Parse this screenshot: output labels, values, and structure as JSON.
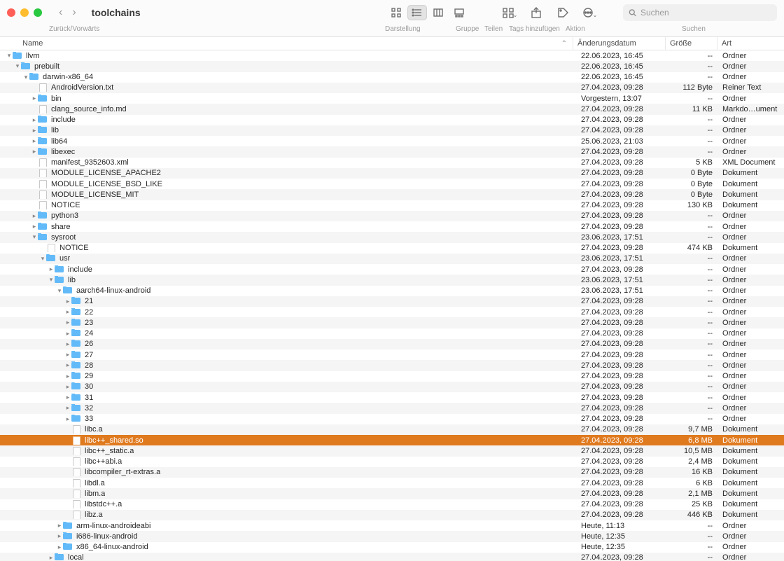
{
  "toolbar": {
    "back_forward_label": "Zurück/Vorwärts",
    "title": "toolchains",
    "view_label": "Darstellung",
    "group_label": "Gruppe",
    "share_label": "Teilen",
    "tags_label": "Tags hinzufügen",
    "action_label": "Aktion",
    "search_label": "Suchen",
    "search_placeholder": "Suchen"
  },
  "columns": {
    "name": "Name",
    "date": "Änderungsdatum",
    "size": "Größe",
    "kind": "Art"
  },
  "rows": [
    {
      "depth": 0,
      "disc": "down",
      "type": "folder",
      "name": "llvm",
      "date": "22.06.2023, 16:45",
      "size": "--",
      "kind": "Ordner",
      "sel": false
    },
    {
      "depth": 1,
      "disc": "down",
      "type": "folder",
      "name": "prebuilt",
      "date": "22.06.2023, 16:45",
      "size": "--",
      "kind": "Ordner",
      "sel": false
    },
    {
      "depth": 2,
      "disc": "down",
      "type": "folder",
      "name": "darwin-x86_64",
      "date": "22.06.2023, 16:45",
      "size": "--",
      "kind": "Ordner",
      "sel": false
    },
    {
      "depth": 3,
      "disc": "none",
      "type": "file",
      "name": "AndroidVersion.txt",
      "date": "27.04.2023, 09:28",
      "size": "112 Byte",
      "kind": "Reiner Text",
      "sel": false
    },
    {
      "depth": 3,
      "disc": "right",
      "type": "folder",
      "name": "bin",
      "date": "Vorgestern, 13:07",
      "size": "--",
      "kind": "Ordner",
      "sel": false
    },
    {
      "depth": 3,
      "disc": "none",
      "type": "file",
      "name": "clang_source_info.md",
      "date": "27.04.2023, 09:28",
      "size": "11 KB",
      "kind": "Markdo…ument",
      "sel": false
    },
    {
      "depth": 3,
      "disc": "right",
      "type": "folder",
      "name": "include",
      "date": "27.04.2023, 09:28",
      "size": "--",
      "kind": "Ordner",
      "sel": false
    },
    {
      "depth": 3,
      "disc": "right",
      "type": "folder",
      "name": "lib",
      "date": "27.04.2023, 09:28",
      "size": "--",
      "kind": "Ordner",
      "sel": false
    },
    {
      "depth": 3,
      "disc": "right",
      "type": "folder",
      "name": "lib64",
      "date": "25.06.2023, 21:03",
      "size": "--",
      "kind": "Ordner",
      "sel": false
    },
    {
      "depth": 3,
      "disc": "right",
      "type": "folder",
      "name": "libexec",
      "date": "27.04.2023, 09:28",
      "size": "--",
      "kind": "Ordner",
      "sel": false
    },
    {
      "depth": 3,
      "disc": "none",
      "type": "file",
      "name": "manifest_9352603.xml",
      "date": "27.04.2023, 09:28",
      "size": "5 KB",
      "kind": "XML Document",
      "sel": false
    },
    {
      "depth": 3,
      "disc": "none",
      "type": "file",
      "name": "MODULE_LICENSE_APACHE2",
      "date": "27.04.2023, 09:28",
      "size": "0 Byte",
      "kind": "Dokument",
      "sel": false
    },
    {
      "depth": 3,
      "disc": "none",
      "type": "file",
      "name": "MODULE_LICENSE_BSD_LIKE",
      "date": "27.04.2023, 09:28",
      "size": "0 Byte",
      "kind": "Dokument",
      "sel": false
    },
    {
      "depth": 3,
      "disc": "none",
      "type": "file",
      "name": "MODULE_LICENSE_MIT",
      "date": "27.04.2023, 09:28",
      "size": "0 Byte",
      "kind": "Dokument",
      "sel": false
    },
    {
      "depth": 3,
      "disc": "none",
      "type": "file",
      "name": "NOTICE",
      "date": "27.04.2023, 09:28",
      "size": "130 KB",
      "kind": "Dokument",
      "sel": false
    },
    {
      "depth": 3,
      "disc": "right",
      "type": "folder",
      "name": "python3",
      "date": "27.04.2023, 09:28",
      "size": "--",
      "kind": "Ordner",
      "sel": false
    },
    {
      "depth": 3,
      "disc": "right",
      "type": "folder",
      "name": "share",
      "date": "27.04.2023, 09:28",
      "size": "--",
      "kind": "Ordner",
      "sel": false
    },
    {
      "depth": 3,
      "disc": "down",
      "type": "folder",
      "name": "sysroot",
      "date": "23.06.2023, 17:51",
      "size": "--",
      "kind": "Ordner",
      "sel": false
    },
    {
      "depth": 4,
      "disc": "none",
      "type": "file",
      "name": "NOTICE",
      "date": "27.04.2023, 09:28",
      "size": "474 KB",
      "kind": "Dokument",
      "sel": false
    },
    {
      "depth": 4,
      "disc": "down",
      "type": "folder",
      "name": "usr",
      "date": "23.06.2023, 17:51",
      "size": "--",
      "kind": "Ordner",
      "sel": false
    },
    {
      "depth": 5,
      "disc": "right",
      "type": "folder",
      "name": "include",
      "date": "27.04.2023, 09:28",
      "size": "--",
      "kind": "Ordner",
      "sel": false
    },
    {
      "depth": 5,
      "disc": "down",
      "type": "folder",
      "name": "lib",
      "date": "23.06.2023, 17:51",
      "size": "--",
      "kind": "Ordner",
      "sel": false
    },
    {
      "depth": 6,
      "disc": "down",
      "type": "folder",
      "name": "aarch64-linux-android",
      "date": "23.06.2023, 17:51",
      "size": "--",
      "kind": "Ordner",
      "sel": false
    },
    {
      "depth": 7,
      "disc": "right",
      "type": "folder",
      "name": "21",
      "date": "27.04.2023, 09:28",
      "size": "--",
      "kind": "Ordner",
      "sel": false
    },
    {
      "depth": 7,
      "disc": "right",
      "type": "folder",
      "name": "22",
      "date": "27.04.2023, 09:28",
      "size": "--",
      "kind": "Ordner",
      "sel": false
    },
    {
      "depth": 7,
      "disc": "right",
      "type": "folder",
      "name": "23",
      "date": "27.04.2023, 09:28",
      "size": "--",
      "kind": "Ordner",
      "sel": false
    },
    {
      "depth": 7,
      "disc": "right",
      "type": "folder",
      "name": "24",
      "date": "27.04.2023, 09:28",
      "size": "--",
      "kind": "Ordner",
      "sel": false
    },
    {
      "depth": 7,
      "disc": "right",
      "type": "folder",
      "name": "26",
      "date": "27.04.2023, 09:28",
      "size": "--",
      "kind": "Ordner",
      "sel": false
    },
    {
      "depth": 7,
      "disc": "right",
      "type": "folder",
      "name": "27",
      "date": "27.04.2023, 09:28",
      "size": "--",
      "kind": "Ordner",
      "sel": false
    },
    {
      "depth": 7,
      "disc": "right",
      "type": "folder",
      "name": "28",
      "date": "27.04.2023, 09:28",
      "size": "--",
      "kind": "Ordner",
      "sel": false
    },
    {
      "depth": 7,
      "disc": "right",
      "type": "folder",
      "name": "29",
      "date": "27.04.2023, 09:28",
      "size": "--",
      "kind": "Ordner",
      "sel": false
    },
    {
      "depth": 7,
      "disc": "right",
      "type": "folder",
      "name": "30",
      "date": "27.04.2023, 09:28",
      "size": "--",
      "kind": "Ordner",
      "sel": false
    },
    {
      "depth": 7,
      "disc": "right",
      "type": "folder",
      "name": "31",
      "date": "27.04.2023, 09:28",
      "size": "--",
      "kind": "Ordner",
      "sel": false
    },
    {
      "depth": 7,
      "disc": "right",
      "type": "folder",
      "name": "32",
      "date": "27.04.2023, 09:28",
      "size": "--",
      "kind": "Ordner",
      "sel": false
    },
    {
      "depth": 7,
      "disc": "right",
      "type": "folder",
      "name": "33",
      "date": "27.04.2023, 09:28",
      "size": "--",
      "kind": "Ordner",
      "sel": false
    },
    {
      "depth": 7,
      "disc": "none",
      "type": "file",
      "name": "libc.a",
      "date": "27.04.2023, 09:28",
      "size": "9,7 MB",
      "kind": "Dokument",
      "sel": false
    },
    {
      "depth": 7,
      "disc": "none",
      "type": "file",
      "name": "libc++_shared.so",
      "date": "27.04.2023, 09:28",
      "size": "6,8 MB",
      "kind": "Dokument",
      "sel": true
    },
    {
      "depth": 7,
      "disc": "none",
      "type": "file",
      "name": "libc++_static.a",
      "date": "27.04.2023, 09:28",
      "size": "10,5 MB",
      "kind": "Dokument",
      "sel": false
    },
    {
      "depth": 7,
      "disc": "none",
      "type": "file",
      "name": "libc++abi.a",
      "date": "27.04.2023, 09:28",
      "size": "2,4 MB",
      "kind": "Dokument",
      "sel": false
    },
    {
      "depth": 7,
      "disc": "none",
      "type": "file",
      "name": "libcompiler_rt-extras.a",
      "date": "27.04.2023, 09:28",
      "size": "16 KB",
      "kind": "Dokument",
      "sel": false
    },
    {
      "depth": 7,
      "disc": "none",
      "type": "file",
      "name": "libdl.a",
      "date": "27.04.2023, 09:28",
      "size": "6 KB",
      "kind": "Dokument",
      "sel": false
    },
    {
      "depth": 7,
      "disc": "none",
      "type": "file",
      "name": "libm.a",
      "date": "27.04.2023, 09:28",
      "size": "2,1 MB",
      "kind": "Dokument",
      "sel": false
    },
    {
      "depth": 7,
      "disc": "none",
      "type": "file",
      "name": "libstdc++.a",
      "date": "27.04.2023, 09:28",
      "size": "25 KB",
      "kind": "Dokument",
      "sel": false
    },
    {
      "depth": 7,
      "disc": "none",
      "type": "file",
      "name": "libz.a",
      "date": "27.04.2023, 09:28",
      "size": "446 KB",
      "kind": "Dokument",
      "sel": false
    },
    {
      "depth": 6,
      "disc": "right",
      "type": "folder",
      "name": "arm-linux-androideabi",
      "date": "Heute, 11:13",
      "size": "--",
      "kind": "Ordner",
      "sel": false
    },
    {
      "depth": 6,
      "disc": "right",
      "type": "folder",
      "name": "i686-linux-android",
      "date": "Heute, 12:35",
      "size": "--",
      "kind": "Ordner",
      "sel": false
    },
    {
      "depth": 6,
      "disc": "right",
      "type": "folder",
      "name": "x86_64-linux-android",
      "date": "Heute, 12:35",
      "size": "--",
      "kind": "Ordner",
      "sel": false
    },
    {
      "depth": 5,
      "disc": "right",
      "type": "folder",
      "name": "local",
      "date": "27.04.2023, 09:28",
      "size": "--",
      "kind": "Ordner",
      "sel": false
    }
  ]
}
